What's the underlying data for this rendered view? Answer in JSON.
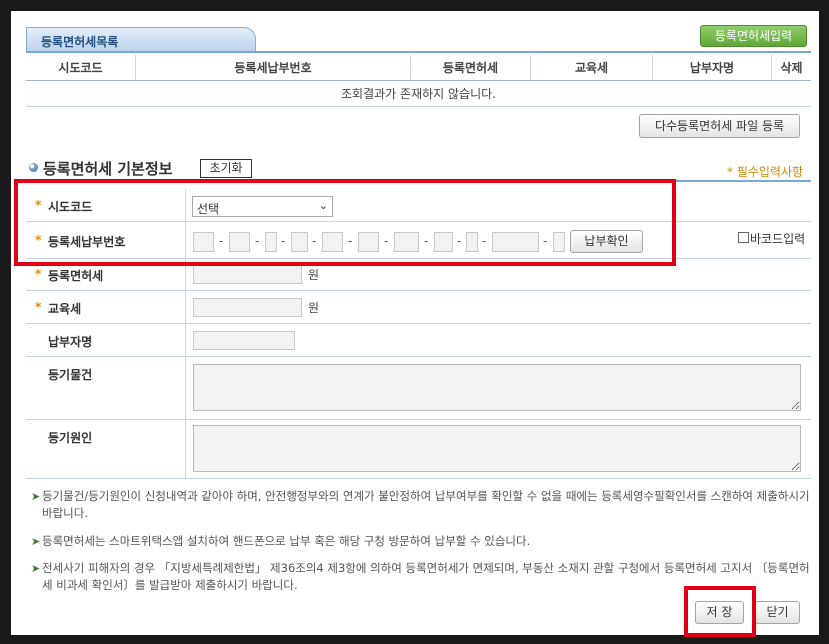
{
  "list_section": {
    "title": "등록면허세목록",
    "register_button": "등록면허세입력",
    "columns": [
      "시도코드",
      "등록세납부번호",
      "등록면허세",
      "교육세",
      "납부자명",
      "삭제"
    ],
    "empty_message": "조회결과가 존재하지 않습니다.",
    "bulk_register_button": "다수등록면허세 파일 등록"
  },
  "form_section": {
    "title": "등록면허세 기본정보",
    "reset_button": "초기화",
    "required_note": "* 필수입력사항",
    "fields": {
      "sido_code": {
        "label": "시도코드",
        "selected": "선택"
      },
      "payment_number": {
        "label": "등록세납부번호",
        "confirm_button": "납부확인",
        "barcode_label": "바코드입력"
      },
      "registration_tax": {
        "label": "등록면허세",
        "unit": "원"
      },
      "education_tax": {
        "label": "교육세",
        "unit": "원"
      },
      "payer_name": {
        "label": "납부자명"
      },
      "registry_item": {
        "label": "등기물건"
      },
      "registry_cause": {
        "label": "등기원인"
      }
    }
  },
  "notes": [
    "등기물건/등기원인이 신청내역과 같아야 하며, 안전행정부와의 연계가 불안정하여 납부여부를 확인할 수 없을 때에는 등록세영수필확인서를 스캔하여 제출하시기 바랍니다.",
    "등록면허세는 스마트위택스앱 설치하여 핸드폰으로 납부 혹은 해당 구청 방문하여 납부할 수 있습니다.",
    "전세사기 피해자의 경우 「지방세특례제한법」 제36조의4 제3항에 의하여 등록면허세가 면제되며, 부동산 소재지 관할 구청에서 등록면허세 고지서 〔등록면허세 비과세 확인서〕를 발급받아 제출하시기 바랍니다."
  ],
  "footer": {
    "save_button": "저 장",
    "close_button": "닫기"
  },
  "colors": {
    "highlight": "#e00012",
    "accent_blue": "#7ea6d2",
    "green_button": "#5ea93a",
    "required_star": "#e08a00"
  }
}
